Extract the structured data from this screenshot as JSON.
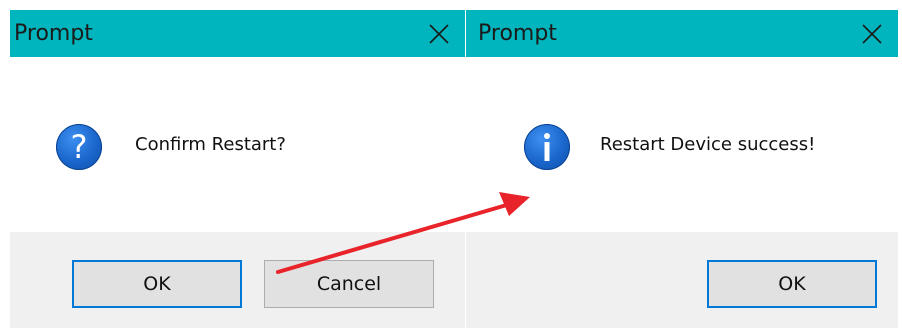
{
  "colors": {
    "titlebar": "#00b5bd",
    "footer": "#f0f0f0",
    "button": "#e1e1e1",
    "button_focus_border": "#0078d7",
    "icon_blue": "#1a66cc",
    "arrow": "#e8242a"
  },
  "dialogs": [
    {
      "title": "Prompt",
      "icon": "question-icon",
      "icon_glyph": "?",
      "message": "Confirm Restart?",
      "buttons": [
        {
          "label": "OK",
          "focused": true
        },
        {
          "label": "Cancel",
          "focused": false
        }
      ]
    },
    {
      "title": "Prompt",
      "icon": "info-icon",
      "message": "Restart Device success!",
      "buttons": [
        {
          "label": "OK",
          "focused": true
        }
      ]
    }
  ]
}
